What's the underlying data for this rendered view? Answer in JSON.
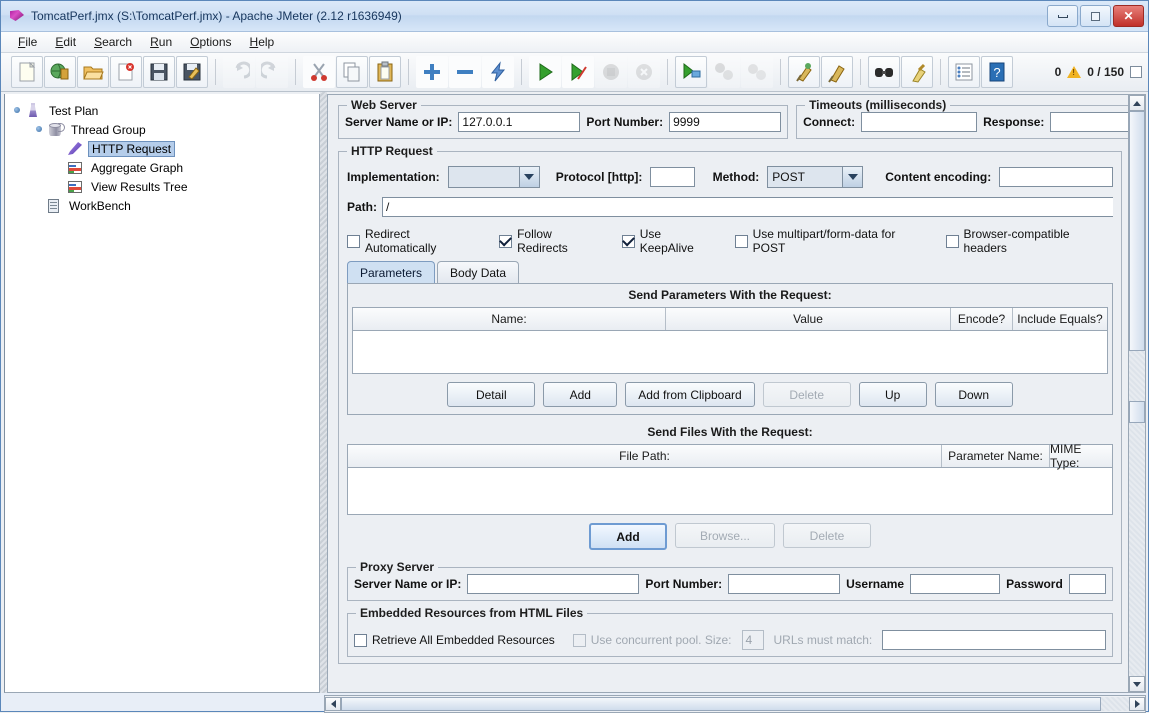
{
  "window": {
    "title": "TomcatPerf.jmx (S:\\TomcatPerf.jmx) - Apache JMeter (2.12 r1636949)",
    "minimize_label": "Minimize",
    "maximize_label": "Maximize",
    "close_label": "Close"
  },
  "menu": [
    {
      "label": "File",
      "mnemonic": "F"
    },
    {
      "label": "Edit",
      "mnemonic": "E"
    },
    {
      "label": "Search",
      "mnemonic": "S"
    },
    {
      "label": "Run",
      "mnemonic": "R"
    },
    {
      "label": "Options",
      "mnemonic": "O"
    },
    {
      "label": "Help",
      "mnemonic": "H"
    }
  ],
  "toolbar": {
    "groups": [
      [
        "new-icon",
        "templates-icon",
        "open-icon",
        "close-icon",
        "save-icon",
        "save-as-icon"
      ],
      [
        "undo-icon",
        "redo-icon"
      ],
      [
        "cut-icon",
        "copy-icon",
        "paste-icon"
      ],
      [
        "expand-icon",
        "collapse-icon",
        "toggle-icon"
      ],
      [
        "start-icon",
        "start-no-pauses-icon",
        "stop-icon",
        "shutdown-icon"
      ],
      [
        "remote-start-all-icon",
        "remote-stop-all-icon",
        "remote-shutdown-all-icon"
      ],
      [
        "clear-icon",
        "clear-all-icon"
      ],
      [
        "search-icon",
        "search-reset-icon"
      ],
      [
        "function-helper-icon",
        "help-icon"
      ]
    ],
    "status": {
      "warning_count": "0",
      "warning_icon": "warning-triangle-icon",
      "threads": "0 / 150"
    }
  },
  "tree": {
    "nodes": [
      {
        "label": "Test Plan",
        "icon": "test-plan-icon",
        "selected": false,
        "depth": 0
      },
      {
        "label": "Thread Group",
        "icon": "thread-group-icon",
        "selected": false,
        "depth": 1
      },
      {
        "label": "HTTP Request",
        "icon": "http-request-icon",
        "selected": true,
        "depth": 2
      },
      {
        "label": "Aggregate Graph",
        "icon": "aggregate-graph-icon",
        "selected": false,
        "depth": 2
      },
      {
        "label": "View Results Tree",
        "icon": "view-results-tree-icon",
        "selected": false,
        "depth": 2
      },
      {
        "label": "WorkBench",
        "icon": "workbench-icon",
        "selected": false,
        "depth": 0
      }
    ]
  },
  "web_server": {
    "group_title": "Web Server",
    "server_name_label": "Server Name or IP:",
    "server_name_value": "127.0.0.1",
    "port_label": "Port Number:",
    "port_value": "9999"
  },
  "timeouts": {
    "group_title": "Timeouts (milliseconds)",
    "connect_label": "Connect:",
    "connect_value": "",
    "response_label": "Response:",
    "response_value": ""
  },
  "http_request": {
    "group_title": "HTTP Request",
    "implementation_label": "Implementation:",
    "implementation_value": "",
    "protocol_label": "Protocol [http]:",
    "protocol_value": "",
    "method_label": "Method:",
    "method_value": "POST",
    "content_encoding_label": "Content encoding:",
    "content_encoding_value": "",
    "path_label": "Path:",
    "path_value": "/",
    "checkboxes": [
      {
        "label": "Redirect Automatically",
        "checked": false,
        "enabled": true
      },
      {
        "label": "Follow Redirects",
        "checked": true,
        "enabled": true
      },
      {
        "label": "Use KeepAlive",
        "checked": true,
        "enabled": true
      },
      {
        "label": "Use multipart/form-data for POST",
        "checked": false,
        "enabled": true
      },
      {
        "label": "Browser-compatible headers",
        "checked": false,
        "enabled": true
      }
    ]
  },
  "tabs": [
    {
      "label": "Parameters",
      "active": true
    },
    {
      "label": "Body Data",
      "active": false
    }
  ],
  "parameters_panel": {
    "title": "Send Parameters With the Request:",
    "columns": [
      "Name:",
      "Value",
      "Encode?",
      "Include Equals?"
    ],
    "rows": [],
    "buttons": [
      {
        "label": "Detail",
        "enabled": true
      },
      {
        "label": "Add",
        "enabled": true
      },
      {
        "label": "Add from Clipboard",
        "enabled": true
      },
      {
        "label": "Delete",
        "enabled": false
      },
      {
        "label": "Up",
        "enabled": true
      },
      {
        "label": "Down",
        "enabled": true
      }
    ]
  },
  "files_panel": {
    "title": "Send Files With the Request:",
    "columns": [
      "File Path:",
      "Parameter Name:",
      "MIME Type:"
    ],
    "rows": [],
    "buttons": [
      {
        "label": "Add",
        "enabled": true,
        "focused": true
      },
      {
        "label": "Browse...",
        "enabled": false
      },
      {
        "label": "Delete",
        "enabled": false
      }
    ]
  },
  "proxy_server": {
    "group_title": "Proxy Server",
    "server_name_label": "Server Name or IP:",
    "server_name_value": "",
    "port_label": "Port Number:",
    "port_value": "",
    "username_label": "Username",
    "username_value": "",
    "password_label": "Password",
    "password_value": ""
  },
  "embedded_resources": {
    "group_title": "Embedded Resources from HTML Files",
    "retrieve_label": "Retrieve All Embedded Resources",
    "retrieve_checked": false,
    "concurrent_label": "Use concurrent pool. Size:",
    "concurrent_checked": false,
    "concurrent_enabled": false,
    "pool_size_value": "4",
    "urls_label": "URLs must match:",
    "urls_value": ""
  },
  "colors": {
    "selection": "#b5cdea",
    "tab_active": "#cfe0f2",
    "panel_bg": "#eceff3",
    "close_button": "#c0302a",
    "warning": "#f0b323"
  }
}
